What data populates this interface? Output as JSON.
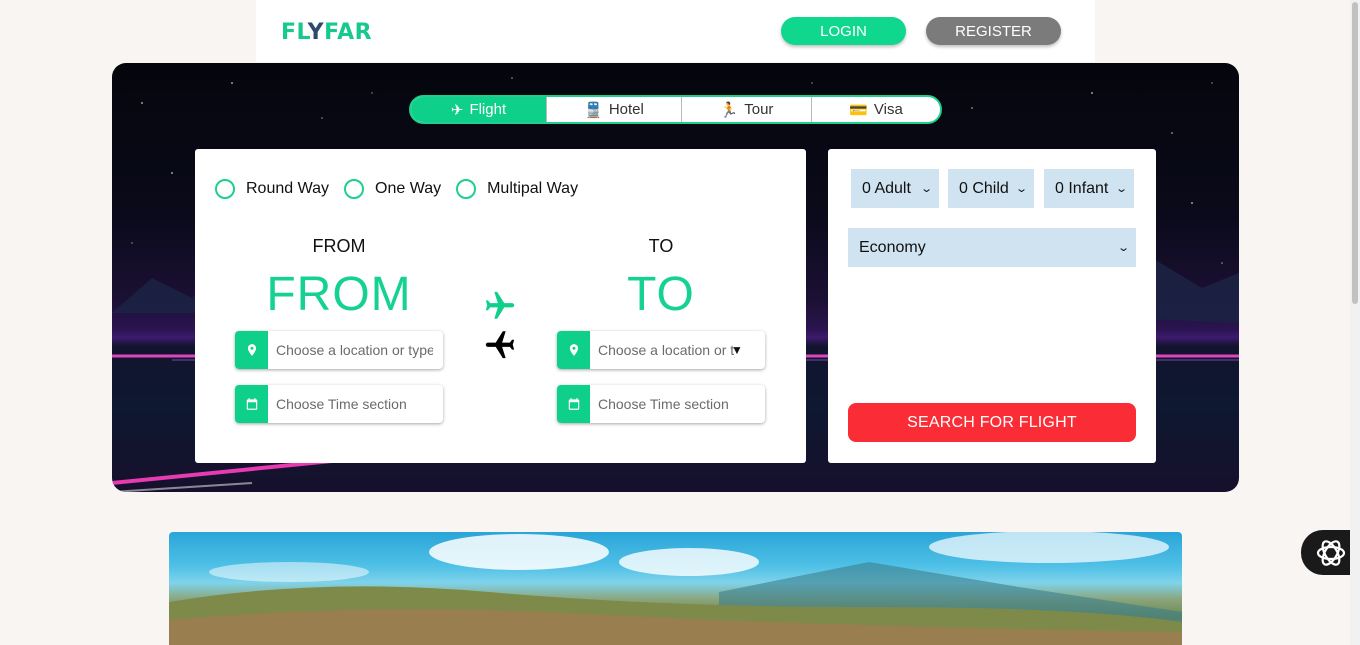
{
  "header": {
    "logo": {
      "part1": "FL",
      "part2": "Y",
      "part3": "FAR"
    },
    "login_label": "LOGIN",
    "register_label": "REGISTER"
  },
  "tabs": [
    {
      "icon": "✈",
      "label": "Flight",
      "active": true
    },
    {
      "icon": "🚆",
      "label": "Hotel",
      "active": false
    },
    {
      "icon": "🏃",
      "label": "Tour",
      "active": false
    },
    {
      "icon": "💳",
      "label": "Visa",
      "active": false
    }
  ],
  "trip_types": [
    "Round Way",
    "One Way",
    "Multipal Way"
  ],
  "from": {
    "heading": "FROM",
    "big": "FROM",
    "location_placeholder": "Choose a location or type",
    "time_placeholder": "Choose Time section"
  },
  "to": {
    "heading": "TO",
    "big": "TO",
    "location_placeholder": "Choose a location or type",
    "time_placeholder": "Choose Time section"
  },
  "passengers": {
    "adult": "0 Adult",
    "child": "0 Child",
    "infant": "0 Infant"
  },
  "cabin_class": "Economy",
  "search_label": "SEARCH FOR FLIGHT",
  "colors": {
    "accent": "#0fd08b",
    "search": "#fa2d37",
    "register": "#7b7b7b",
    "select_bg": "#cfe3f0"
  }
}
